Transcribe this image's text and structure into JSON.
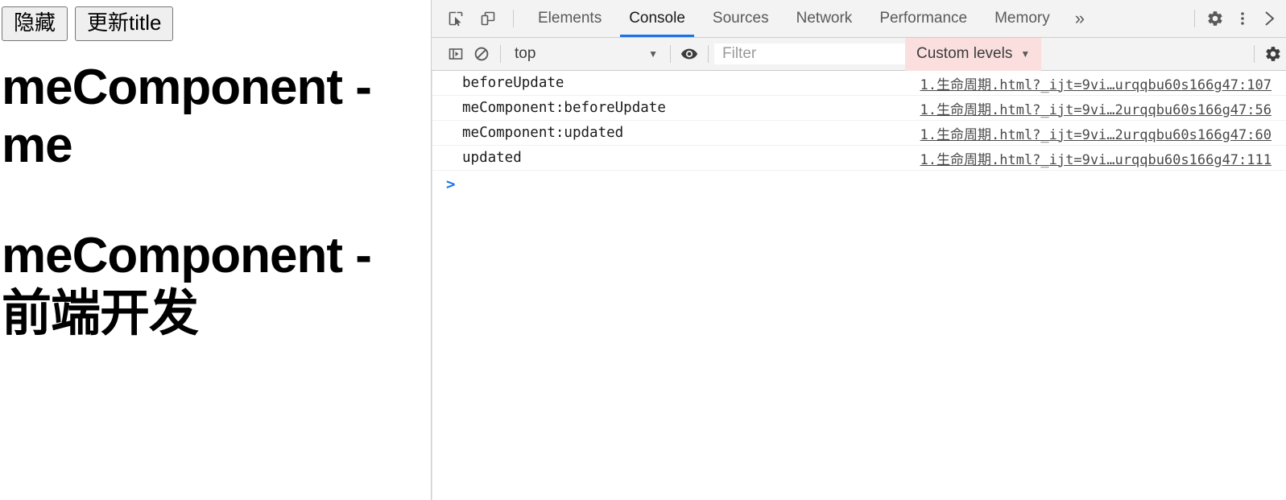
{
  "page": {
    "buttons": [
      {
        "label": "隐藏",
        "name": "hide-button"
      },
      {
        "label": "更新title",
        "name": "update-title-button"
      }
    ],
    "headings": [
      "meComponent - me",
      "meComponent - 前端开发"
    ]
  },
  "devtools": {
    "toolbar_icons": {
      "inspect": "inspect-element-icon",
      "device": "device-toolbar-icon"
    },
    "tabs": [
      {
        "label": "Elements",
        "active": false
      },
      {
        "label": "Console",
        "active": true
      },
      {
        "label": "Sources",
        "active": false
      },
      {
        "label": "Network",
        "active": false
      },
      {
        "label": "Performance",
        "active": false
      },
      {
        "label": "Memory",
        "active": false
      }
    ],
    "more_tabs_label": "»",
    "right_icons": {
      "settings": "gear-icon",
      "menu": "kebab-menu-icon",
      "close": "close-icon"
    },
    "console_toolbar": {
      "sidebar_toggle": "console-sidebar-toggle-icon",
      "clear": "clear-console-icon",
      "context": "top",
      "context_caret": "▼",
      "eye": "live-expression-icon",
      "filter_placeholder": "Filter",
      "filter_value": "",
      "levels_label": "Custom levels",
      "levels_caret": "▼",
      "levels_bg": "#fbdfdf",
      "settings": "console-settings-gear-icon"
    },
    "messages": [
      {
        "text": "beforeUpdate",
        "source": "1.生命周期.html?_ijt=9vi…urqqbu60s166g47:107"
      },
      {
        "text": "meComponent:beforeUpdate",
        "source": "1.生命周期.html?_ijt=9vi…2urqqbu60s166g47:56"
      },
      {
        "text": "meComponent:updated",
        "source": "1.生命周期.html?_ijt=9vi…2urqqbu60s166g47:60"
      },
      {
        "text": "updated",
        "source": "1.生命周期.html?_ijt=9vi…urqqbu60s166g47:111"
      }
    ],
    "prompt": {
      "caret": ">",
      "value": ""
    }
  },
  "colors": {
    "accent": "#1a73e8",
    "toolbar_bg": "#f3f3f3",
    "levels_highlight": "#fbdfdf",
    "border": "#cdcdcd"
  }
}
